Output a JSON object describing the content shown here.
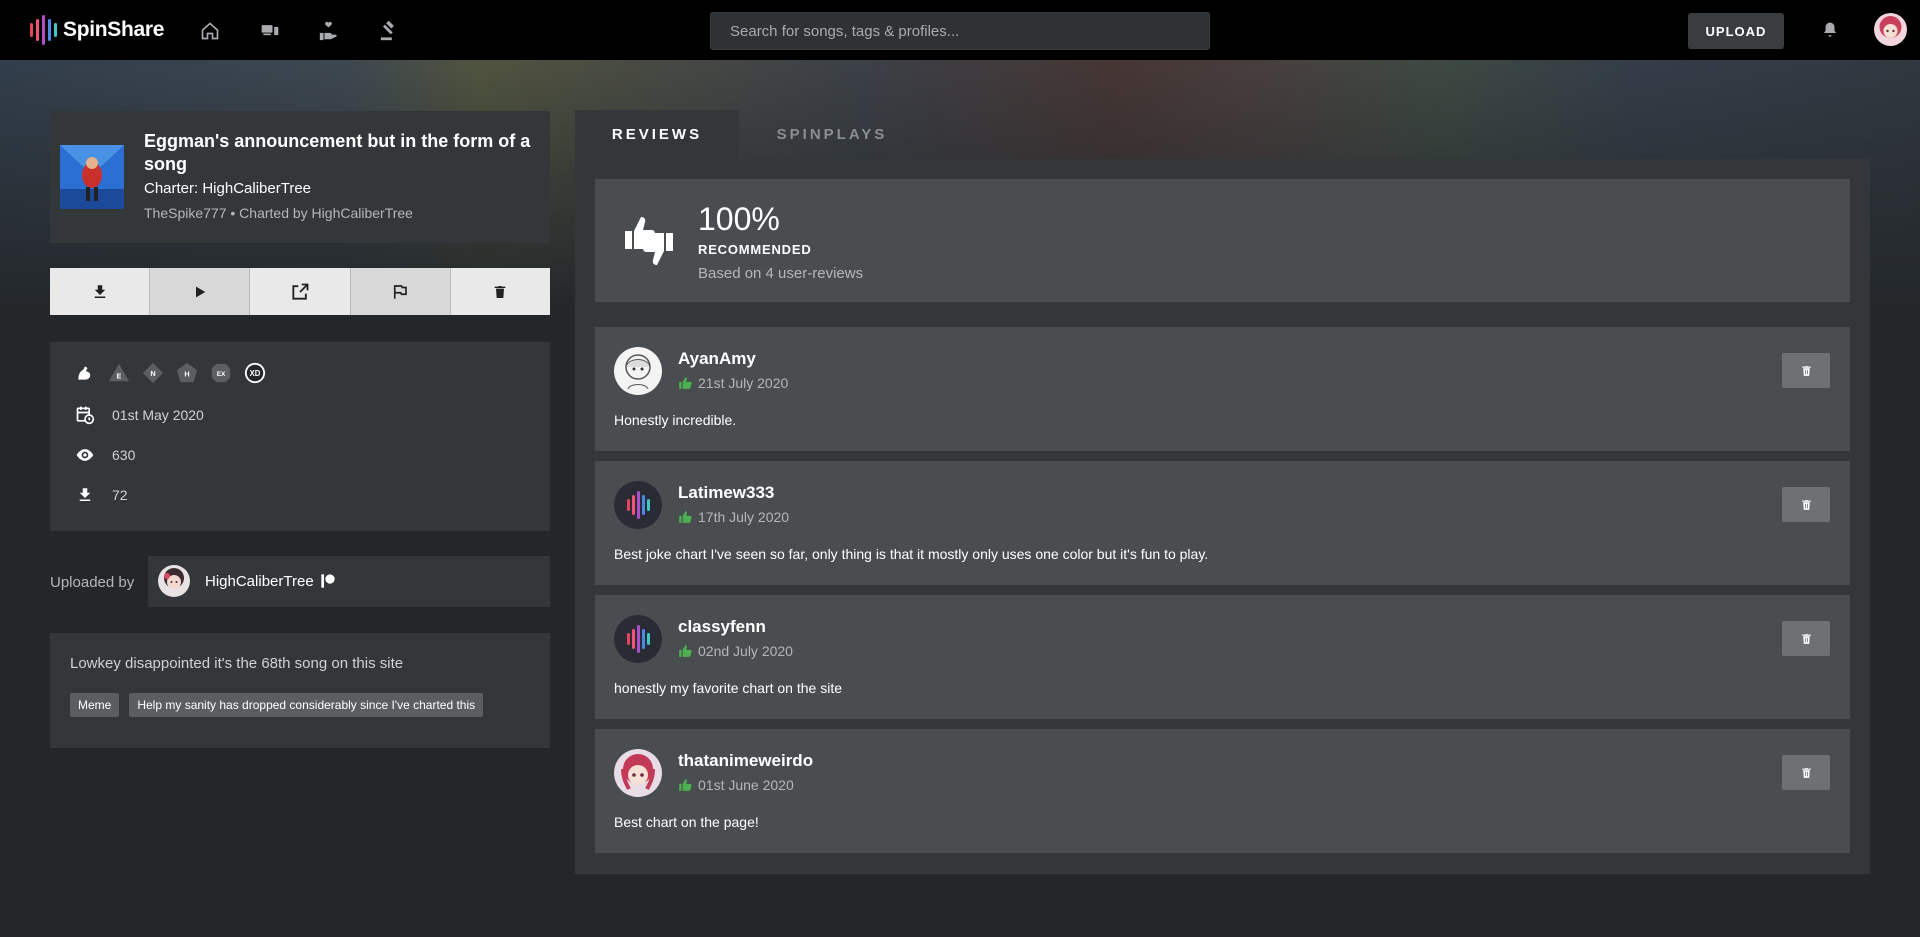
{
  "topbar": {
    "brand": "SpinShare",
    "nav_icons": [
      "home-icon",
      "devices-icon",
      "hand-heart-icon",
      "gavel-icon"
    ],
    "search_placeholder": "Search for songs, tags & profiles...",
    "upload_label": "UPLOAD"
  },
  "song": {
    "title": "Eggman's announcement but in the form of a song",
    "charter": "Charter: HighCaliberTree",
    "subtitle": "TheSpike777 • Charted by HighCaliberTree"
  },
  "actions": [
    "download-icon",
    "play-icon",
    "open-external-icon",
    "flag-icon",
    "delete-icon"
  ],
  "meta": {
    "difficulties": [
      "E",
      "N",
      "H",
      "EX",
      "XD"
    ],
    "date": "01st May 2020",
    "views": "630",
    "downloads": "72"
  },
  "uploader": {
    "label": "Uploaded by",
    "name": "HighCaliberTree"
  },
  "description": {
    "text": "Lowkey disappointed it's the 68th song on this site",
    "tags": [
      "Meme",
      "Help my sanity has dropped considerably since I've charted this"
    ]
  },
  "tabs": [
    "REVIEWS",
    "SPINPLAYS"
  ],
  "summary": {
    "percent": "100%",
    "recommended": "RECOMMENDED",
    "based_on": "Based on 4 user-reviews"
  },
  "reviews": [
    {
      "name": "AyanAmy",
      "date": "21st July 2020",
      "text": "Honestly incredible."
    },
    {
      "name": "Latimew333",
      "date": "17th July 2020",
      "text": "Best joke chart I've seen so far, only thing is that it mostly only uses one color but it's fun to play."
    },
    {
      "name": "classyfenn",
      "date": "02nd July 2020",
      "text": "honestly my favorite chart on the site"
    },
    {
      "name": "thatanimeweirdo",
      "date": "01st June 2020",
      "text": "Best chart on the page!"
    }
  ],
  "colors": {
    "accent_green": "#4caf50",
    "background": "#23272a",
    "card": "#34373a",
    "review_card": "#4a4d50"
  }
}
